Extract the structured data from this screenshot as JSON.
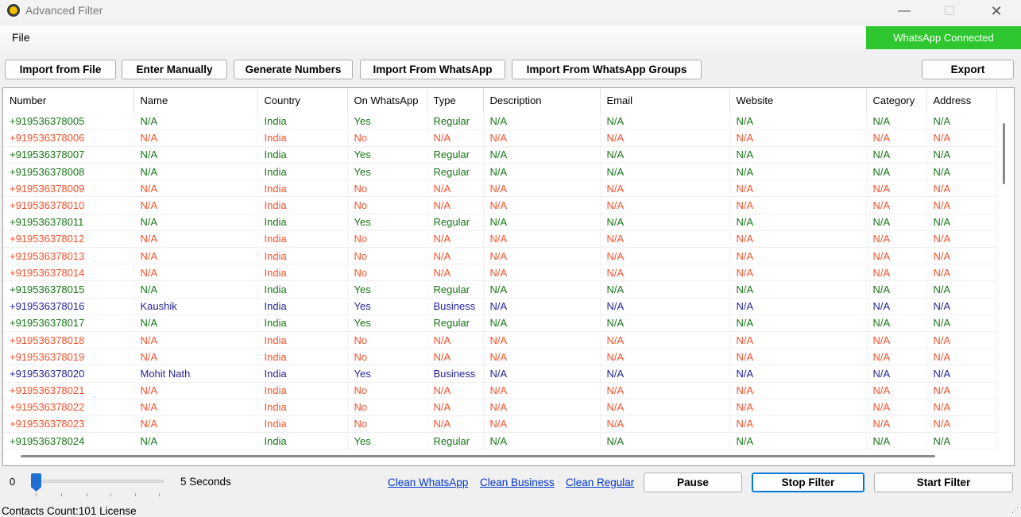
{
  "window": {
    "title": "Advanced Filter"
  },
  "menu": {
    "file": "File"
  },
  "status": {
    "connected": "WhatsApp Connected",
    "connected_color": "#2fc72f"
  },
  "toolbar": {
    "import_file": "Import from File",
    "enter_manually": "Enter Manually",
    "generate_numbers": "Generate Numbers",
    "import_whatsapp": "Import From WhatsApp",
    "import_groups": "Import From WhatsApp Groups",
    "export": "Export"
  },
  "table": {
    "columns": [
      "Number",
      "Name",
      "Country",
      "On WhatsApp",
      "Type",
      "Description",
      "Email",
      "Website",
      "Category",
      "Address"
    ],
    "rows": [
      [
        "+919536378005",
        "N/A",
        "India",
        "Yes",
        "Regular",
        "N/A",
        "N/A",
        "N/A",
        "N/A",
        "N/A"
      ],
      [
        "+919536378006",
        "N/A",
        "India",
        "No",
        "N/A",
        "N/A",
        "N/A",
        "N/A",
        "N/A",
        "N/A"
      ],
      [
        "+919536378007",
        "N/A",
        "India",
        "Yes",
        "Regular",
        "N/A",
        "N/A",
        "N/A",
        "N/A",
        "N/A"
      ],
      [
        "+919536378008",
        "N/A",
        "India",
        "Yes",
        "Regular",
        "N/A",
        "N/A",
        "N/A",
        "N/A",
        "N/A"
      ],
      [
        "+919536378009",
        "N/A",
        "India",
        "No",
        "N/A",
        "N/A",
        "N/A",
        "N/A",
        "N/A",
        "N/A"
      ],
      [
        "+919536378010",
        "N/A",
        "India",
        "No",
        "N/A",
        "N/A",
        "N/A",
        "N/A",
        "N/A",
        "N/A"
      ],
      [
        "+919536378011",
        "N/A",
        "India",
        "Yes",
        "Regular",
        "N/A",
        "N/A",
        "N/A",
        "N/A",
        "N/A"
      ],
      [
        "+919536378012",
        "N/A",
        "India",
        "No",
        "N/A",
        "N/A",
        "N/A",
        "N/A",
        "N/A",
        "N/A"
      ],
      [
        "+919536378013",
        "N/A",
        "India",
        "No",
        "N/A",
        "N/A",
        "N/A",
        "N/A",
        "N/A",
        "N/A"
      ],
      [
        "+919536378014",
        "N/A",
        "India",
        "No",
        "N/A",
        "N/A",
        "N/A",
        "N/A",
        "N/A",
        "N/A"
      ],
      [
        "+919536378015",
        "N/A",
        "India",
        "Yes",
        "Regular",
        "N/A",
        "N/A",
        "N/A",
        "N/A",
        "N/A"
      ],
      [
        "+919536378016",
        "Kaushik",
        "India",
        "Yes",
        "Business",
        "N/A",
        "N/A",
        "N/A",
        "N/A",
        "N/A"
      ],
      [
        "+919536378017",
        "N/A",
        "India",
        "Yes",
        "Regular",
        "N/A",
        "N/A",
        "N/A",
        "N/A",
        "N/A"
      ],
      [
        "+919536378018",
        "N/A",
        "India",
        "No",
        "N/A",
        "N/A",
        "N/A",
        "N/A",
        "N/A",
        "N/A"
      ],
      [
        "+919536378019",
        "N/A",
        "India",
        "No",
        "N/A",
        "N/A",
        "N/A",
        "N/A",
        "N/A",
        "N/A"
      ],
      [
        "+919536378020",
        "Mohit Nath",
        "India",
        "Yes",
        "Business",
        "N/A",
        "N/A",
        "N/A",
        "N/A",
        "N/A"
      ],
      [
        "+919536378021",
        "N/A",
        "India",
        "No",
        "N/A",
        "N/A",
        "N/A",
        "N/A",
        "N/A",
        "N/A"
      ],
      [
        "+919536378022",
        "N/A",
        "India",
        "No",
        "N/A",
        "N/A",
        "N/A",
        "N/A",
        "N/A",
        "N/A"
      ],
      [
        "+919536378023",
        "N/A",
        "India",
        "No",
        "N/A",
        "N/A",
        "N/A",
        "N/A",
        "N/A",
        "N/A"
      ],
      [
        "+919536378024",
        "N/A",
        "India",
        "Yes",
        "Regular",
        "N/A",
        "N/A",
        "N/A",
        "N/A",
        "N/A"
      ]
    ],
    "colors": {
      "regular": "#167516",
      "not_on_whatsapp": "#f4512c",
      "business": "#24249a"
    }
  },
  "controls": {
    "slider_min": "0",
    "slider_label": "5 Seconds",
    "slider_value_fraction": 0,
    "clean_whatsapp": "Clean WhatsApp",
    "clean_business": "Clean Business",
    "clean_regular": "Clean Regular",
    "pause": "Pause",
    "stop_filter": "Stop Filter",
    "start_filter": "Start Filter"
  },
  "footer": {
    "contacts_count": "Contacts Count:101",
    "license": "License"
  }
}
